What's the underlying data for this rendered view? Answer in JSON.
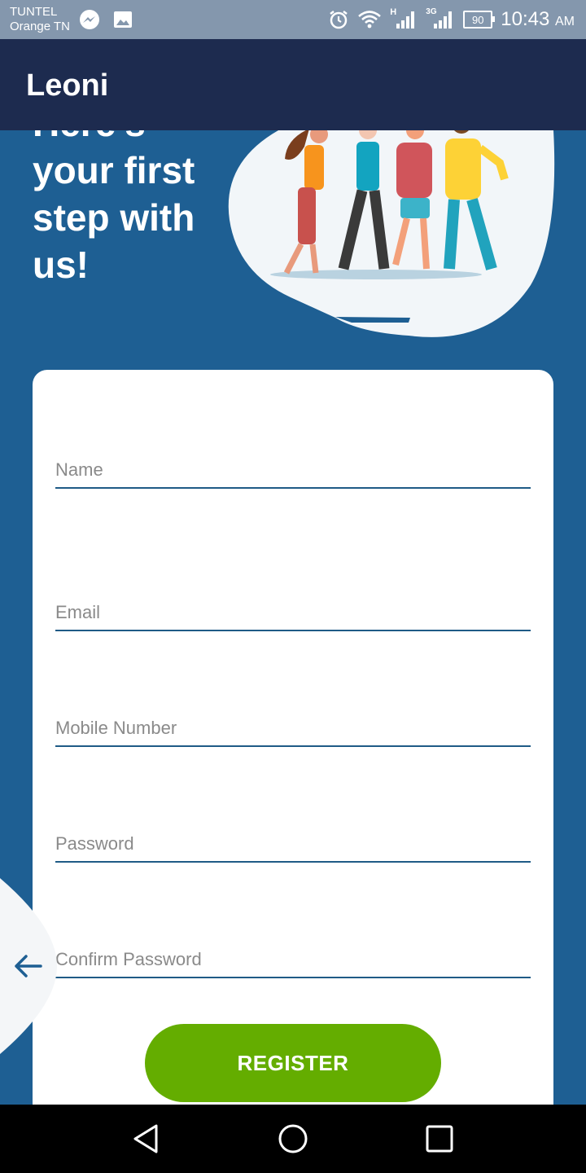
{
  "status_bar": {
    "carrier_line1": "TUNTEL",
    "carrier_line2": "Orange TN",
    "left_icons": [
      "messenger-icon",
      "image-icon"
    ],
    "right_icons": [
      "alarm-icon",
      "wifi-icon",
      "signal-h-icon",
      "signal-3g-icon"
    ],
    "signal1_label": "H",
    "signal2_label": "3G",
    "battery": "90",
    "time": "10:43",
    "ampm": "AM"
  },
  "app_bar": {
    "title": "Leoni"
  },
  "hero": {
    "line0": "Here's",
    "line1": "your first",
    "line2": "step with",
    "line3": "us!",
    "illustration": "group-of-friends-illustration"
  },
  "form": {
    "name_placeholder": "Name",
    "email_placeholder": "Email",
    "mobile_placeholder": "Mobile Number",
    "password_placeholder": "Password",
    "confirm_placeholder": "Confirm Password",
    "register_label": "REGISTER"
  },
  "colors": {
    "background": "#1e5f93",
    "app_bar": "#1d2b4f",
    "status_bar": "#8497ad",
    "button": "#64ad00",
    "underline": "#1f5b86"
  },
  "nav_icons": [
    "back-triangle-icon",
    "home-circle-icon",
    "recents-square-icon"
  ]
}
